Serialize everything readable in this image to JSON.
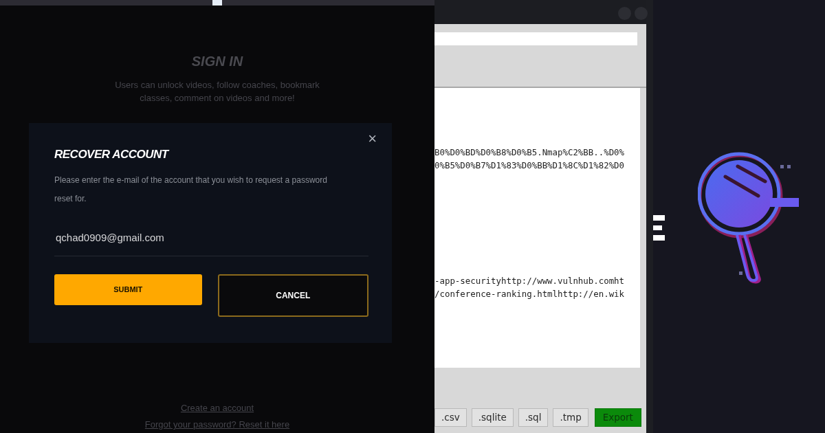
{
  "background_page": {
    "heading": "SIGN IN",
    "description": "Users can unlock videos, follow coaches, bookmark classes, comment on videos and more!",
    "links": [
      "Create an account",
      "Forgot your password? Reset it here"
    ]
  },
  "recover_dialog": {
    "title": "RECOVER ACCOUNT",
    "close": "×",
    "message": "Please enter the e-mail of the account that you wish to request a password reset for.",
    "email_value": "qchad0909@gmail.com",
    "buttons": [
      {
        "label": "SUBMIT",
        "kind": "primary"
      },
      {
        "label": "CANCEL",
        "kind": "outline"
      }
    ]
  },
  "export_window": {
    "text_lines": [
      "B0%D0%BD%D0%B8%D0%B5.Nmap%C2%BB..%D0%",
      "0%B5%D0%B7%D1%83%D0%BB%D1%8C%D1%82%D0",
      "-app-securityhttp://www.vulnhub.comht",
      "/conference-ranking.htmlhttp://en.wik"
    ],
    "buttons": [
      {
        "label": ".csv",
        "kind": "plain"
      },
      {
        "label": ".sqlite",
        "kind": "plain"
      },
      {
        "label": ".sql",
        "kind": "plain"
      },
      {
        "label": ".tmp",
        "kind": "plain"
      },
      {
        "label": "Export",
        "kind": "export"
      }
    ]
  }
}
